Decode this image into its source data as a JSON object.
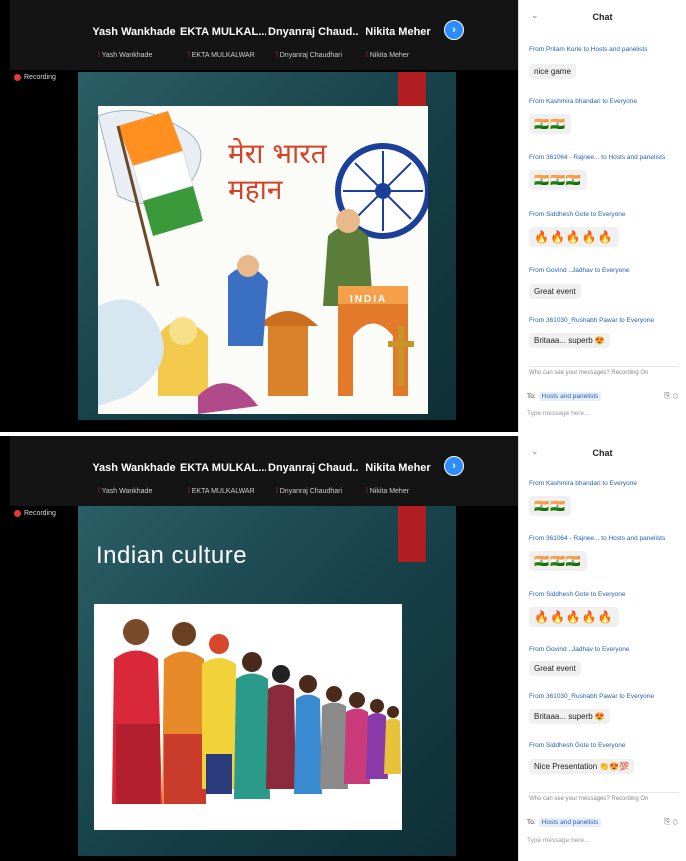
{
  "panel1": {
    "participants": [
      {
        "name": "Yash Wankhade",
        "sub": "Yash Wankhade"
      },
      {
        "name": "EKTA MULKAL...",
        "sub": "EKTA MULKALWAR"
      },
      {
        "name": "Dnyanraj Chaud...",
        "sub": "Dnyanraj Chaudhari"
      },
      {
        "name": "Nikita Meher",
        "sub": "Nikita Meher"
      }
    ],
    "recording": "Recording",
    "slide": {
      "art_text": "मेरा भारत महान",
      "banner_text": "INDIA"
    },
    "chat": {
      "title": "Chat",
      "messages": [
        {
          "from": "From Pritam Korle to Hosts and panelists",
          "text": "nice game"
        },
        {
          "from": "From Kashmira bhandari to Everyone",
          "text": "🇮🇳🇮🇳"
        },
        {
          "from": "From 361064 - Rajnee... to Hosts and panelists",
          "text": "🇮🇳🇮🇳🇮🇳"
        },
        {
          "from": "From Siddhesh Gote to Everyone",
          "text": "🔥🔥🔥🔥🔥"
        },
        {
          "from": "From Govind ..Jadhav to Everyone",
          "text": "Great event"
        },
        {
          "from": "From 361030_Rushabh Pawar to Everyone",
          "text": "Britaaa... superb 😍"
        }
      ],
      "seen": "Who can see your messages? Recording On",
      "to_label": "To:",
      "to_value": "Hosts and panelists",
      "placeholder": "Type message here..."
    }
  },
  "panel2": {
    "participants": [
      {
        "name": "Yash Wankhade",
        "sub": "Yash Wankhade"
      },
      {
        "name": "EKTA MULKAL...",
        "sub": "EKTA MULKALWAR"
      },
      {
        "name": "Dnyanraj Chaud...",
        "sub": "Dnyanraj Chaudhari"
      },
      {
        "name": "Nikita Meher",
        "sub": "Nikita Meher"
      }
    ],
    "recording": "Recording",
    "slide": {
      "title": "Indian culture"
    },
    "chat": {
      "title": "Chat",
      "messages": [
        {
          "from": "From Kashmira bhandari to Everyone",
          "text": "🇮🇳🇮🇳"
        },
        {
          "from": "From 361064 - Rajnee... to Hosts and panelists",
          "text": "🇮🇳🇮🇳🇮🇳"
        },
        {
          "from": "From Siddhesh Gote to Everyone",
          "text": "🔥🔥🔥🔥🔥"
        },
        {
          "from": "From Govind ..Jadhav to Everyone",
          "text": "Great event"
        },
        {
          "from": "From 361030_Rushabh Pawar to Everyone",
          "text": "Britaaa... superb 😍"
        },
        {
          "from": "From Siddhesh Gote to Everyone",
          "text": "Nice Presentation 👏😍💯"
        }
      ],
      "seen": "Who can see your messages? Recording On",
      "to_label": "To:",
      "to_value": "Hosts and panelists",
      "placeholder": "Type message here..."
    }
  },
  "colors": {
    "accent": "#2d8cff",
    "recording": "#e23b3b",
    "slide_bg": "#1c4a52",
    "red_bar": "#b01e22",
    "link": "#2463b8"
  }
}
